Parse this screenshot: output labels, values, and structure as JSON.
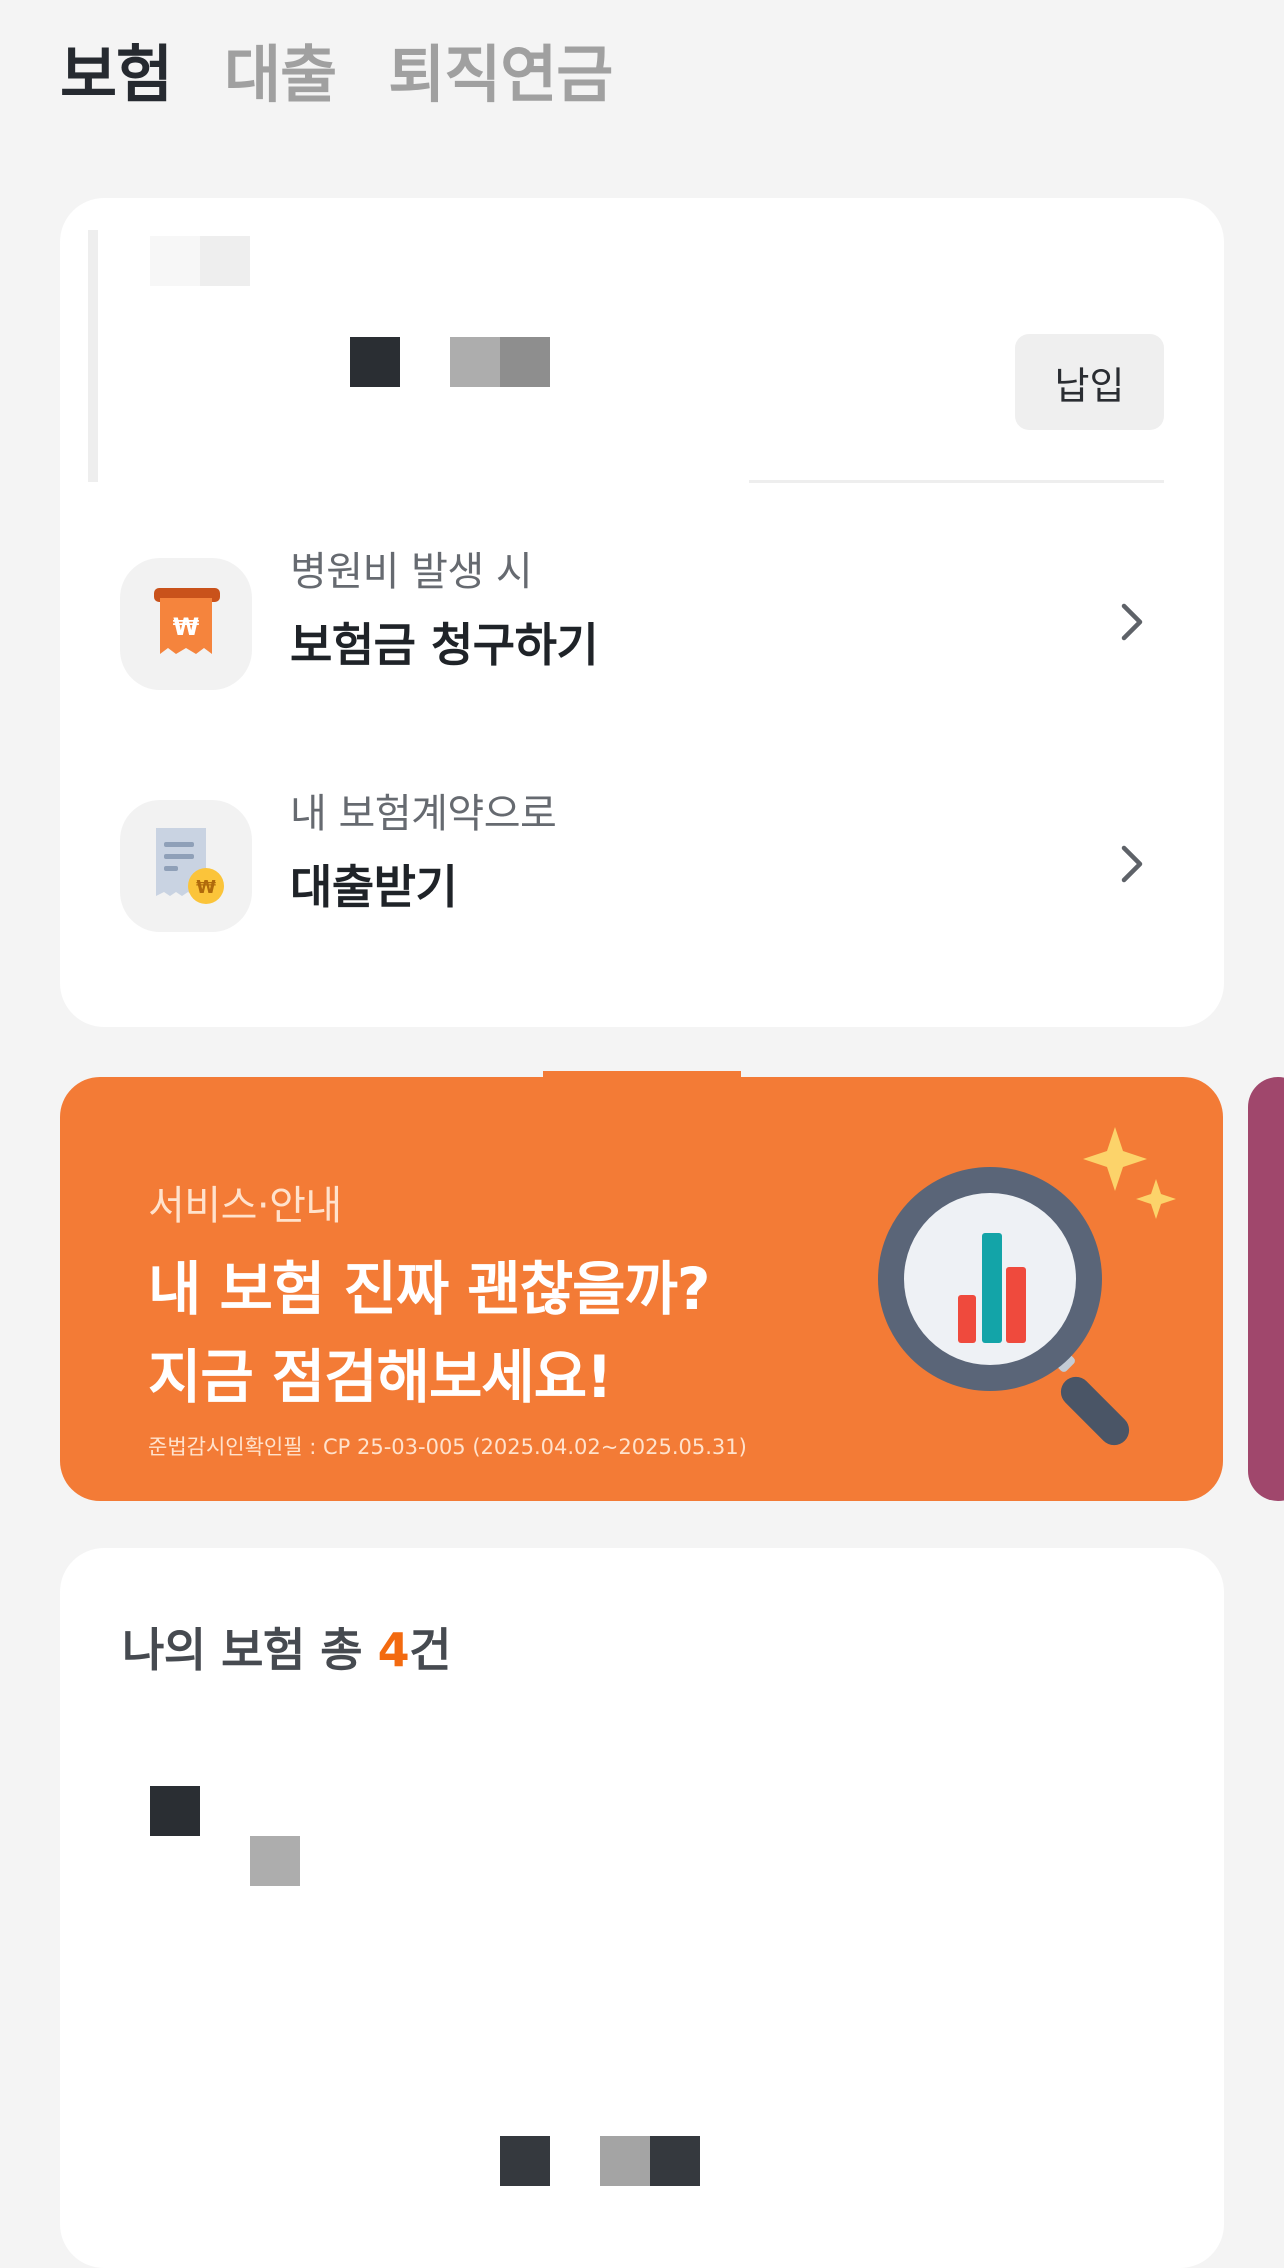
{
  "tabs": [
    {
      "label": "보험",
      "active": true
    },
    {
      "label": "대출",
      "active": false
    },
    {
      "label": "퇴직연금",
      "active": false
    }
  ],
  "summary": {
    "pay_button_label": "납입"
  },
  "actions": [
    {
      "subtitle": "병원비 발생 시",
      "title": "보험금 청구하기",
      "icon": "claim-receipt-icon"
    },
    {
      "subtitle": "내 보험계약으로",
      "title": "대출받기",
      "icon": "loan-document-icon"
    }
  ],
  "banner": {
    "category": "서비스·안내",
    "title_line1": "내 보험 진짜 괜찮을까?",
    "title_line2": "지금 점검해보세요!",
    "compliance_note": "준법감시인확인필 : CP 25-03-005 (2025.04.02~2025.05.31)",
    "icon": "magnifier-chart-icon",
    "background_color": "#f37b36"
  },
  "policies": {
    "prefix": "나의 보험 총 ",
    "count": "4",
    "suffix": "건",
    "accent_color": "#f36a10"
  }
}
